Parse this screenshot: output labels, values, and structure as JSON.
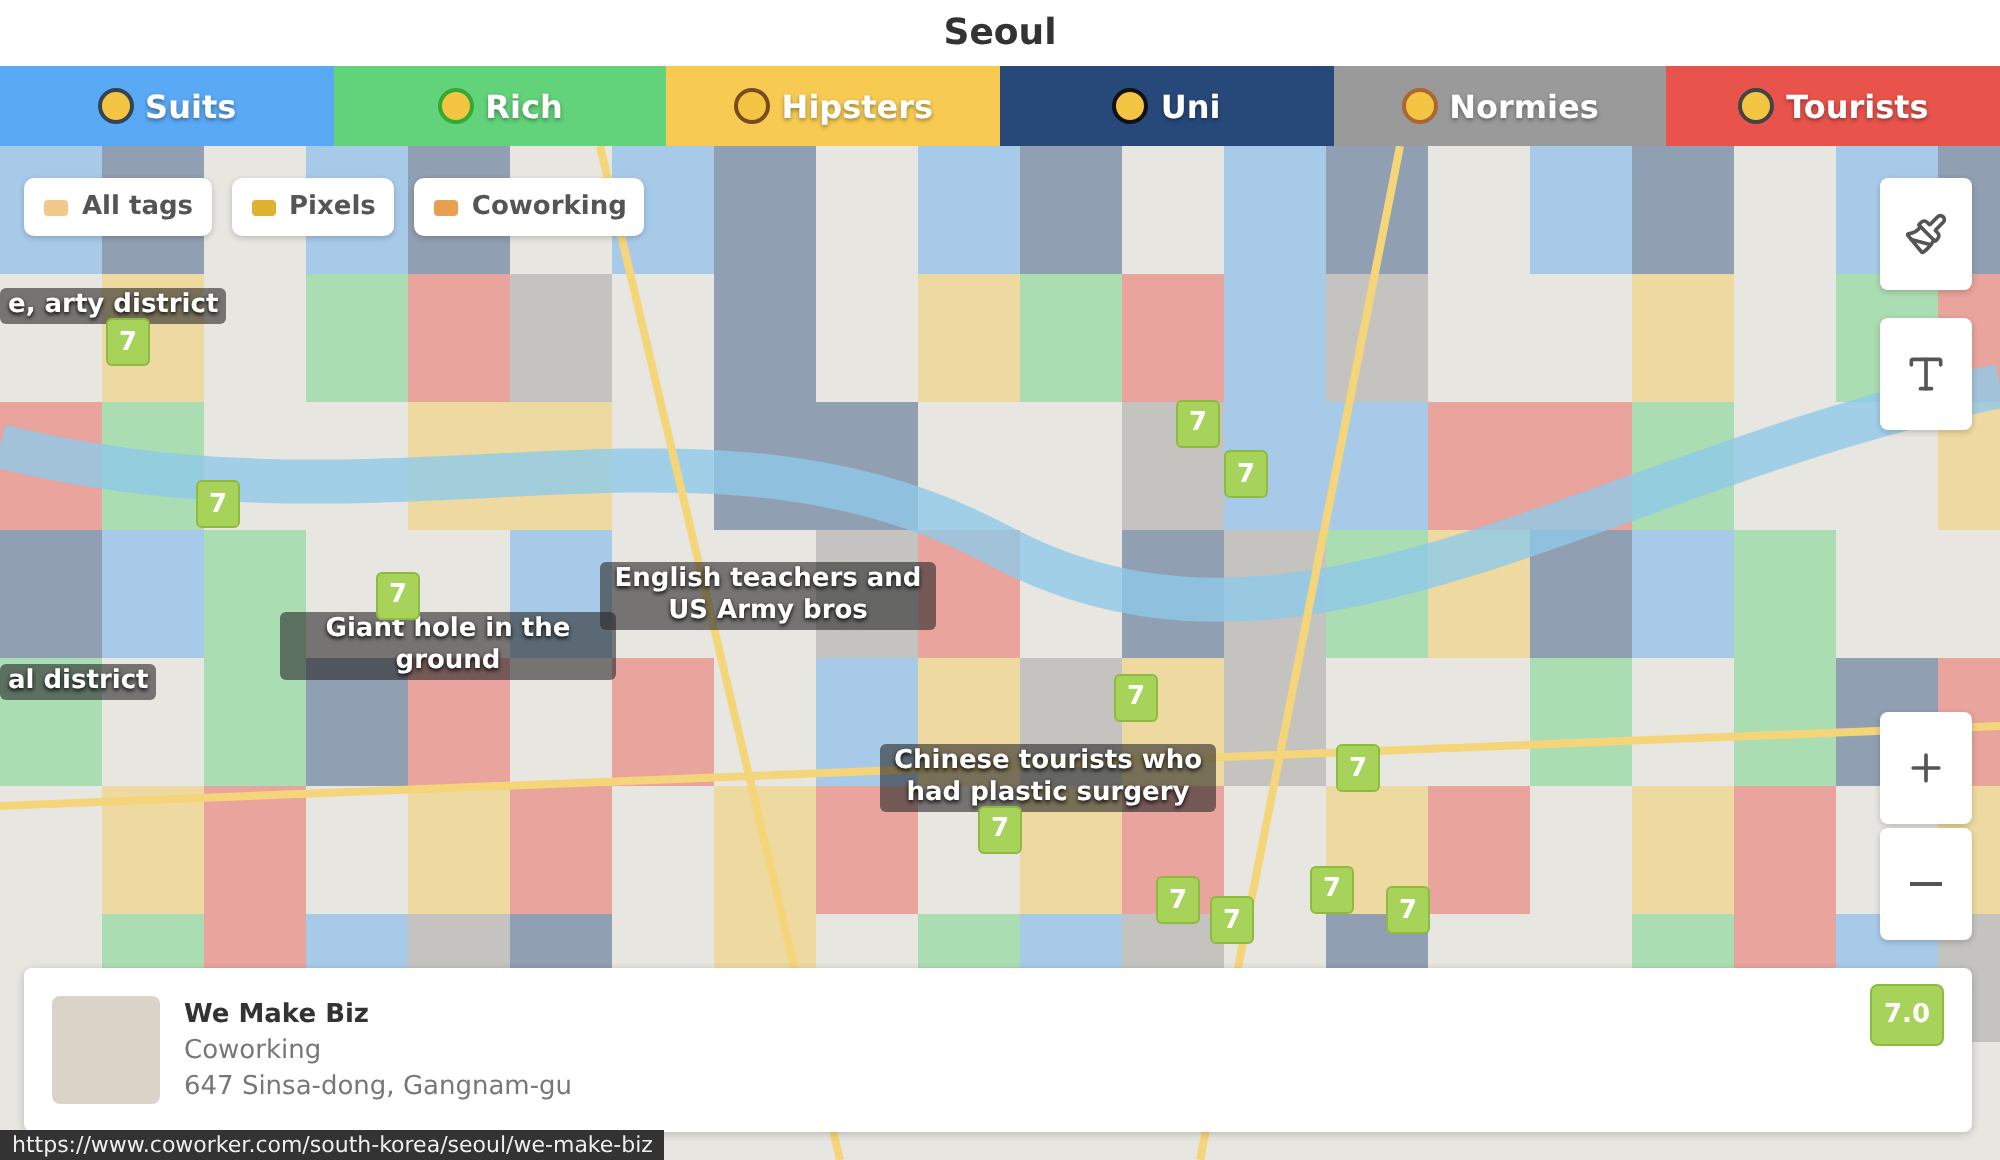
{
  "title": "Seoul",
  "tabs": [
    {
      "label": "Suits",
      "color": "#5aa9f5"
    },
    {
      "label": "Rich",
      "color": "#62d37a"
    },
    {
      "label": "Hipsters",
      "color": "#f7cb52"
    },
    {
      "label": "Uni",
      "color": "#27497a"
    },
    {
      "label": "Normies",
      "color": "#9a9a9a"
    },
    {
      "label": "Tourists",
      "color": "#e8544c"
    }
  ],
  "filters": [
    "All tags",
    "Pixels",
    "Coworking"
  ],
  "annotations": [
    "e, arty district",
    "Giant hole in the ground",
    "English teachers and US Army bros",
    "Chinese tourists who had plastic surgery",
    "al district"
  ],
  "markers": [
    "7",
    "7",
    "7",
    "7",
    "7",
    "7",
    "7",
    "7",
    "7",
    "7",
    "7",
    "7"
  ],
  "card": {
    "name": "We Make Biz",
    "category": "Coworking",
    "address": "647 Sinsa-dong, Gangnam-gu",
    "score": "7.0"
  },
  "status_url": "https://www.coworker.com/south-korea/seoul/we-make-biz"
}
